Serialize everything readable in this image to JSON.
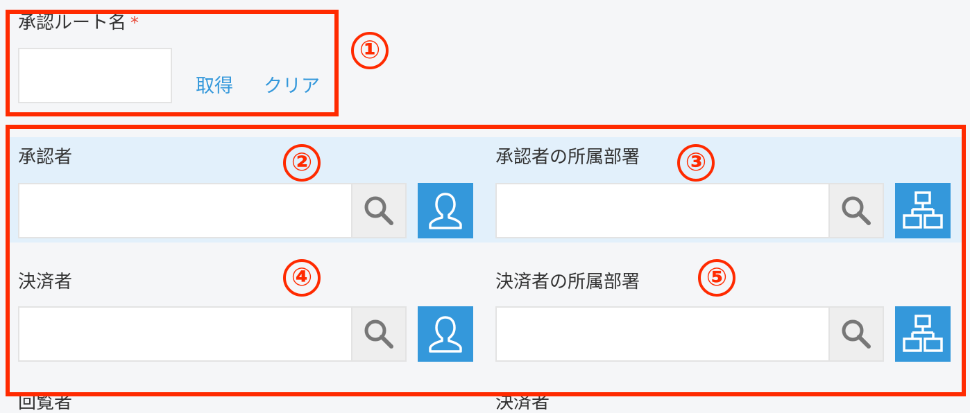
{
  "route": {
    "label": "承認ルート名",
    "required_mark": "*",
    "value": "",
    "get_label": "取得",
    "clear_label": "クリア"
  },
  "approver": {
    "label": "承認者",
    "value": ""
  },
  "approver_dept": {
    "label": "承認者の所属部署",
    "value": ""
  },
  "decider": {
    "label": "決済者",
    "value": ""
  },
  "decider_dept": {
    "label": "決済者の所属部署",
    "value": ""
  },
  "partial_labels": {
    "left": "回覧者",
    "right": "決済者"
  },
  "annotations": [
    "①",
    "②",
    "③",
    "④",
    "⑤"
  ],
  "colors": {
    "annotation": "#ff2a00",
    "link": "#3498db",
    "picker_button": "#3498db",
    "highlight_band": "#e2f0fb",
    "required": "#e74c3c"
  },
  "icons": {
    "search": "search-icon",
    "user": "user-icon",
    "org": "org-chart-icon"
  }
}
